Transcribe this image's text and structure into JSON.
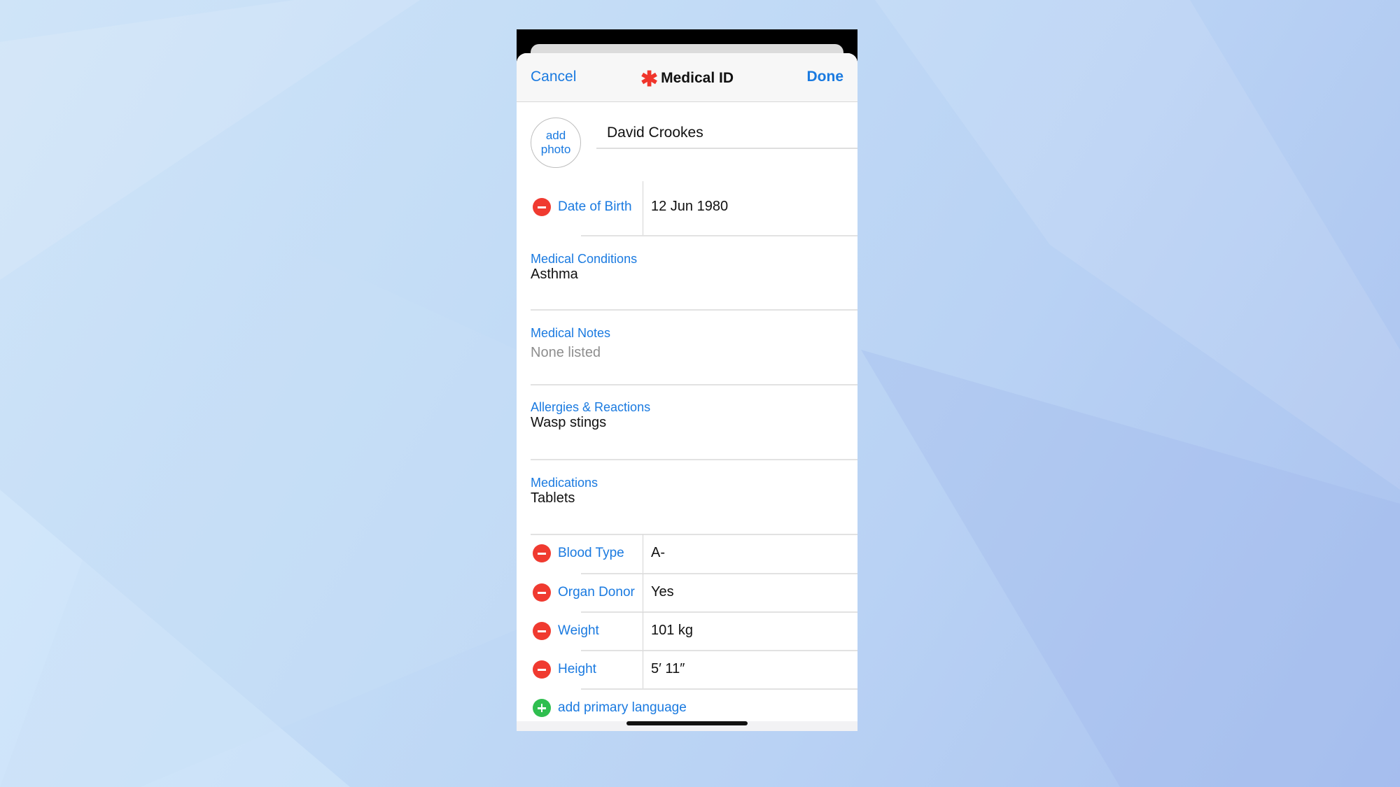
{
  "colors": {
    "accent": "#1a7ae0",
    "remove": "#f03a30",
    "add": "#2fbe4f",
    "title_star": "#f0352b"
  },
  "header": {
    "cancel": "Cancel",
    "title": "Medical ID",
    "title_icon": "asterisk-icon",
    "done": "Done"
  },
  "profile": {
    "photo_label": "add photo",
    "name": "David Crookes"
  },
  "dob": {
    "label": "Date of Birth",
    "value": "12 Jun 1980"
  },
  "sections": [
    {
      "label": "Medical Conditions",
      "value": "Asthma"
    },
    {
      "label": "Medical Notes",
      "value": "None listed"
    },
    {
      "label": "Allergies & Reactions",
      "value": "Wasp stings"
    },
    {
      "label": "Medications",
      "value": "Tablets"
    }
  ],
  "fields": [
    {
      "label": "Blood Type",
      "value": "A-"
    },
    {
      "label": "Organ Donor",
      "value": "Yes"
    },
    {
      "label": "Weight",
      "value": "101 kg"
    },
    {
      "label": "Height",
      "value": "5′ 11″"
    }
  ],
  "add_language": "add primary language"
}
